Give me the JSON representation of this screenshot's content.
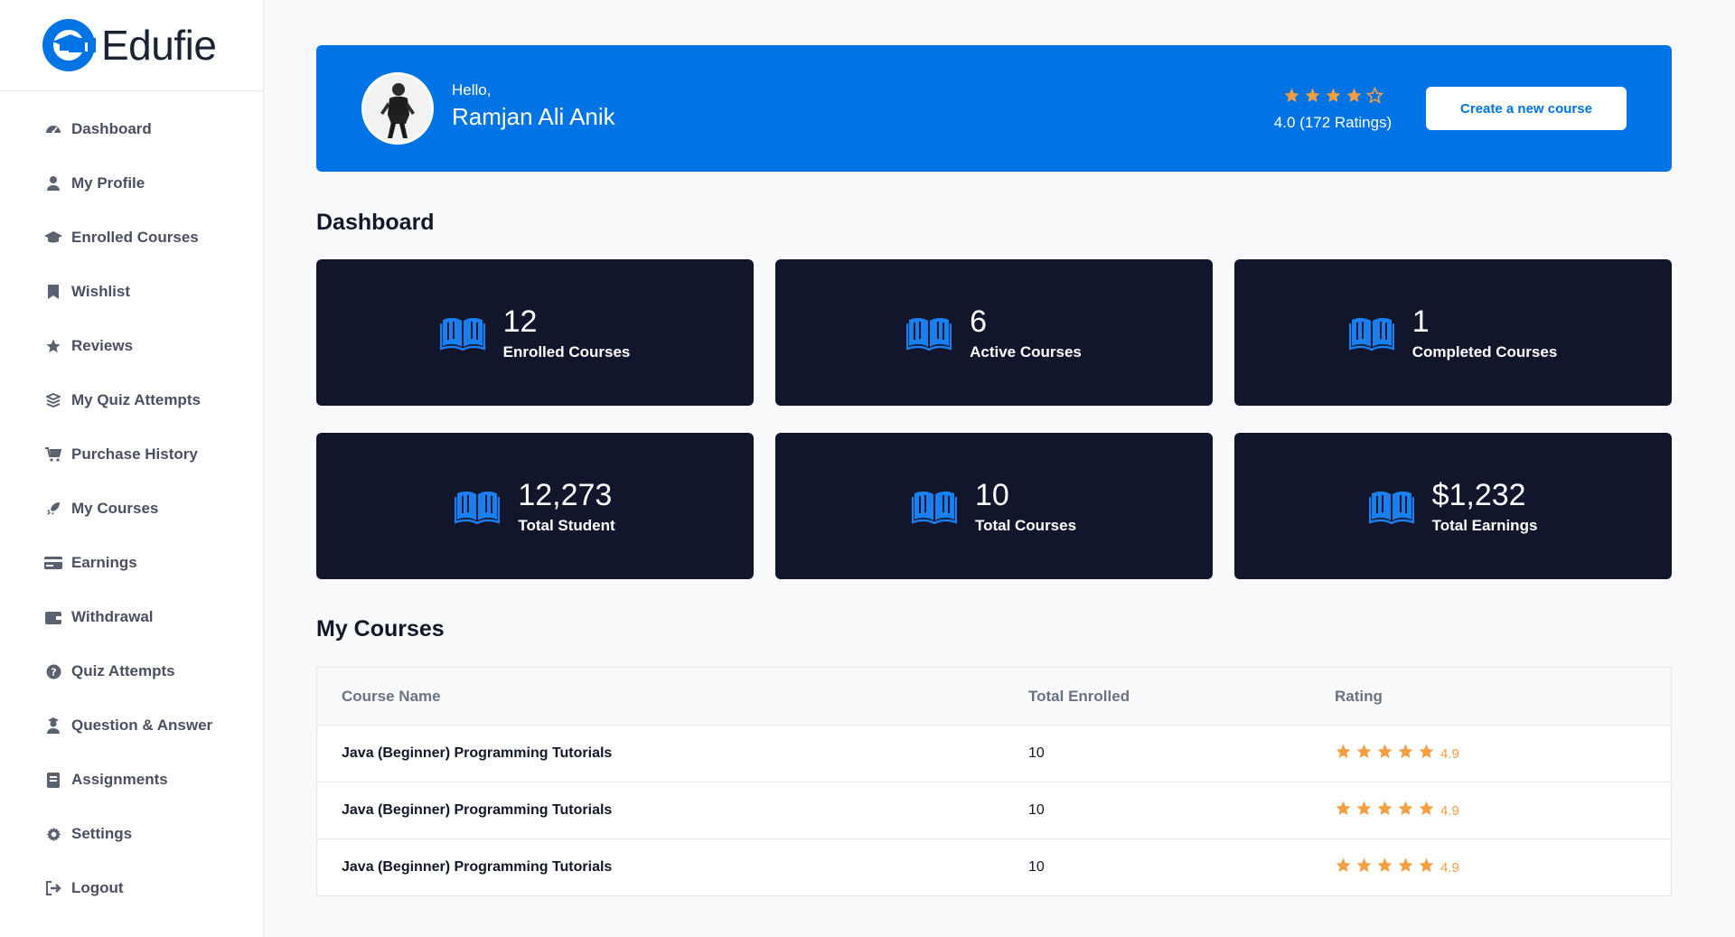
{
  "brand": {
    "name": "Edufie",
    "color": "#0074e4"
  },
  "sidebar": {
    "items": [
      {
        "label": "Dashboard",
        "icon": "gauge-icon"
      },
      {
        "label": "My Profile",
        "icon": "user-icon"
      },
      {
        "label": "Enrolled Courses",
        "icon": "graduation-cap-icon"
      },
      {
        "label": "Wishlist",
        "icon": "bookmark-icon"
      },
      {
        "label": "Reviews",
        "icon": "star-icon"
      },
      {
        "label": "My Quiz Attempts",
        "icon": "layers-icon"
      },
      {
        "label": "Purchase History",
        "icon": "cart-icon"
      },
      {
        "label": "My Courses",
        "icon": "rocket-icon"
      },
      {
        "label": "Earnings",
        "icon": "card-icon"
      },
      {
        "label": "Withdrawal",
        "icon": "wallet-icon"
      },
      {
        "label": "Quiz Attempts",
        "icon": "question-circle-icon"
      },
      {
        "label": "Question & Answer",
        "icon": "user-graduate-icon"
      },
      {
        "label": "Assignments",
        "icon": "book-icon"
      },
      {
        "label": "Settings",
        "icon": "gear-icon"
      },
      {
        "label": "Logout",
        "icon": "sign-out-icon"
      }
    ]
  },
  "hero": {
    "greeting": "Hello,",
    "name": "Ramjan Ali Anik",
    "rating_text": "4.0 (172 Ratings)",
    "rating_value": 4,
    "rating_max": 5,
    "create_button": "Create a new course"
  },
  "dashboard": {
    "title": "Dashboard",
    "stats": [
      {
        "value": "12",
        "label": "Enrolled Courses"
      },
      {
        "value": "6",
        "label": "Active Courses"
      },
      {
        "value": "1",
        "label": "Completed Courses"
      },
      {
        "value": "12,273",
        "label": "Total Student"
      },
      {
        "value": "10",
        "label": "Total Courses"
      },
      {
        "value": "$1,232",
        "label": "Total Earnings"
      }
    ]
  },
  "my_courses": {
    "title": "My Courses",
    "columns": [
      "Course Name",
      "Total Enrolled",
      "Rating"
    ],
    "rows": [
      {
        "name": "Java (Beginner) Programming Tutorials",
        "enrolled": "10",
        "rating": "4.9",
        "stars": 5
      },
      {
        "name": "Java (Beginner) Programming Tutorials",
        "enrolled": "10",
        "rating": "4.9",
        "stars": 5
      },
      {
        "name": "Java (Beginner) Programming Tutorials",
        "enrolled": "10",
        "rating": "4.9",
        "stars": 5
      }
    ]
  },
  "colors": {
    "accent": "#0074e4",
    "card_bg": "#12162c",
    "star": "#f59e42"
  }
}
